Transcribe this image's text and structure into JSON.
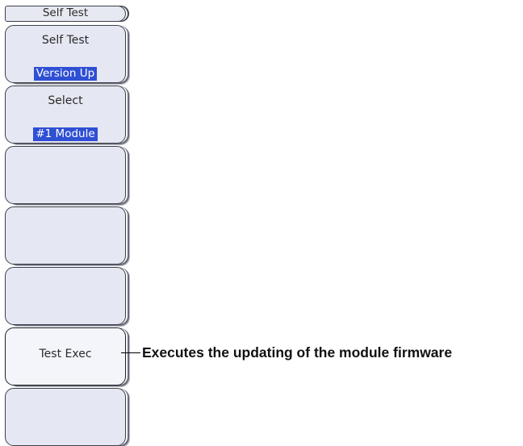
{
  "menu": {
    "title": "Self Test",
    "keys": [
      {
        "label": "Self Test",
        "value": "Version Up"
      },
      {
        "label": "Select",
        "value": "#1 Module"
      },
      {
        "label": ""
      },
      {
        "label": ""
      },
      {
        "label": ""
      },
      {
        "label": "Test Exec"
      },
      {
        "label": ""
      }
    ]
  },
  "callout": {
    "text": "Executes the updating of the module firmware"
  }
}
